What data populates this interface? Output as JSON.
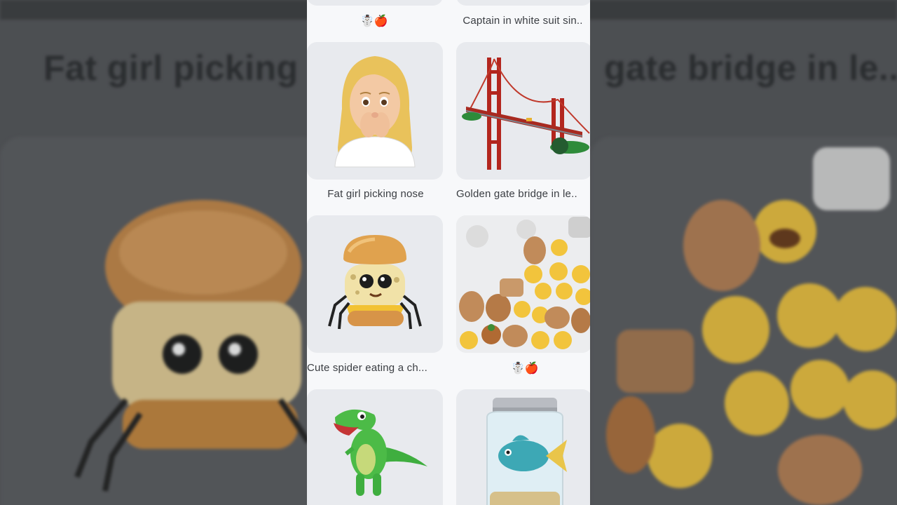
{
  "background": {
    "left_title": "Fat girl picking n",
    "right_title": "gate bridge in le.."
  },
  "grid": {
    "row0": {
      "left_caption_icons": [
        "snowman-icon",
        "apple-icon"
      ],
      "left_caption_glyphs": "☃️🍎",
      "right_caption": "Captain in white suit sin.."
    },
    "row1": {
      "left_caption": "Fat girl picking nose",
      "right_caption": "Golden gate bridge in le.."
    },
    "row2": {
      "left_caption": "Cute spider eating a ch...",
      "right_caption_glyphs": "☃️🍎"
    },
    "row3": {
      "left_image": "green-dinosaur",
      "right_image": "fish-in-jar"
    }
  },
  "colors": {
    "tile": "#e8eaee",
    "panel": "#f7f8fa",
    "caption": "#3a3d42"
  }
}
